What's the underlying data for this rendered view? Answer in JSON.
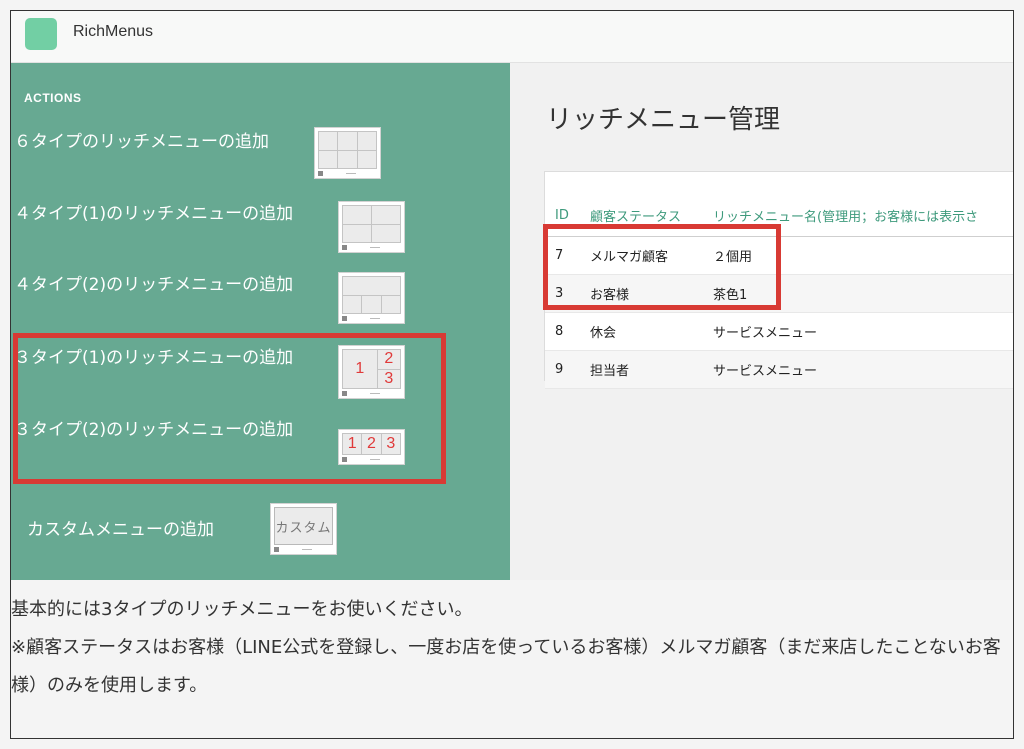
{
  "app": {
    "title": "RichMenus"
  },
  "sidebar": {
    "heading": "ACTIONS",
    "actions": [
      {
        "label": "６タイプのリッチメニューの追加"
      },
      {
        "label": "４タイプ(1)のリッチメニューの追加"
      },
      {
        "label": "４タイプ(2)のリッチメニューの追加"
      },
      {
        "label": "３タイプ(1)のリッチメニューの追加",
        "cells": [
          "1",
          "2",
          "3"
        ]
      },
      {
        "label": "３タイプ(2)のリッチメニューの追加",
        "cells": [
          "1",
          "2",
          "3"
        ]
      },
      {
        "label": "カスタムメニューの追加",
        "thumb_text": "カスタム"
      }
    ]
  },
  "main": {
    "title": "リッチメニュー管理",
    "table": {
      "headers": [
        "ID",
        "顧客ステータス",
        "リッチメニュー名(管理用；お客様には表示さ"
      ],
      "rows": [
        [
          "7",
          "メルマガ顧客",
          "２個用"
        ],
        [
          "3",
          "お客様",
          "茶色1"
        ],
        [
          "8",
          "休会",
          "サービスメニュー"
        ],
        [
          "9",
          "担当者",
          "サービスメニュー"
        ]
      ]
    }
  },
  "notes": {
    "line1": "基本的には3タイプのリッチメニューをお使いください。",
    "line2": "※顧客ステータスはお客様（LINE公式を登録し、一度お店を使っているお客様）メルマガ顧客（まだ来店したことないお客様）のみを使用します。"
  },
  "colors": {
    "sidebar": "#67a992",
    "accent": "#3e9a7c",
    "highlight": "#d83a34",
    "logo": "#72cfa4"
  }
}
